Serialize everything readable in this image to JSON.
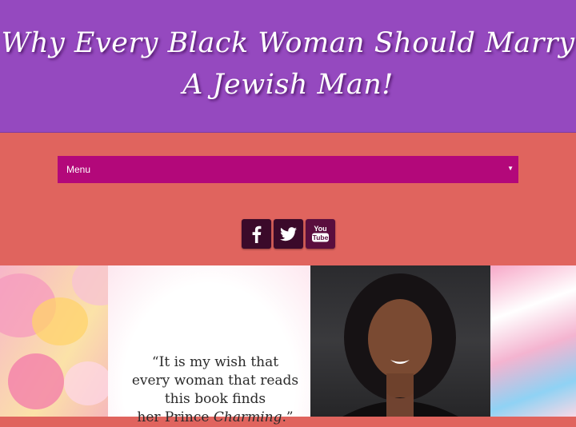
{
  "header": {
    "title": "Why Every Black Woman Should Marry A Jewish Man!"
  },
  "nav": {
    "menu_label": "Menu",
    "menu_arrow": "▼"
  },
  "social": [
    {
      "name": "facebook",
      "label": "f"
    },
    {
      "name": "twitter",
      "label": "twitter"
    },
    {
      "name": "youtube",
      "label_top": "You",
      "label_bottom": "Tube"
    }
  ],
  "banner": {
    "quote_line1": "“It is my wish that",
    "quote_line2": "every woman that reads",
    "quote_line3": "this book finds",
    "quote_line4_start": "her Prince ",
    "quote_line4_italic": "Charming",
    "quote_line4_end": ".”"
  },
  "colors": {
    "header_bg": "#9549bf",
    "band_bg": "#e0645e",
    "menu_bg": "#b3087a"
  }
}
